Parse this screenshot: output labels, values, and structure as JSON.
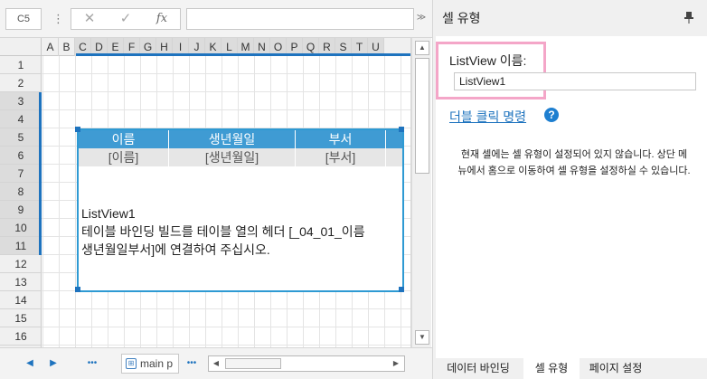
{
  "formula_bar": {
    "cell_ref": "C5",
    "more": "⋮",
    "cancel_glyph": "✕",
    "confirm_glyph": "✓",
    "function_label": "fx",
    "formula_value": "",
    "expand_glyph": "≫"
  },
  "grid": {
    "columns": [
      "A",
      "B",
      "C",
      "D",
      "E",
      "F",
      "G",
      "H",
      "I",
      "J",
      "K",
      "L",
      "M",
      "N",
      "O",
      "P",
      "Q",
      "R",
      "S",
      "T",
      "U"
    ],
    "rows": [
      "1",
      "2",
      "3",
      "4",
      "5",
      "6",
      "7",
      "8",
      "9",
      "10",
      "11",
      "12",
      "13",
      "14",
      "15",
      "16"
    ],
    "selected_columns": [
      "C",
      "D",
      "E",
      "F",
      "G",
      "H",
      "I",
      "J",
      "K",
      "L",
      "M",
      "N",
      "O",
      "P",
      "Q",
      "R",
      "S",
      "T",
      "U"
    ],
    "selected_rows": [
      "3",
      "4",
      "5",
      "6",
      "7",
      "8",
      "9",
      "10",
      "11"
    ]
  },
  "listview": {
    "headers": [
      "이름",
      "생년월일",
      "부서"
    ],
    "bindings": [
      "[이름]",
      "[생년월일]",
      "[부서]"
    ],
    "message_line1": "ListView1",
    "message_line2": "테이블 바인딩 빌드를 테이블 열의 헤더 [_04_01_이름",
    "message_line3": "생년월일부서]에 연결하여 주십시오."
  },
  "bottom_bar": {
    "prev_glyph": "◀",
    "next_glyph": "▶",
    "more_left": "•••",
    "sheet_tab_label": "main p",
    "more_right": "•••",
    "hscroll_left": "◀",
    "hscroll_right": "▶"
  },
  "vscroll": {
    "up": "▲",
    "down": "▼"
  },
  "panel": {
    "title": "셀 유형",
    "pin_glyph": "📌",
    "listview_name_label": "ListView 이름:",
    "listview_name_value": "ListView1",
    "double_click_link": "더블 클릭 명령",
    "help_glyph": "?",
    "info_text": "현재 셀에는 셀 유형이 설정되어 있지 않습니다. 상단 메뉴에서 홈으로 이동하여 셀 유형을 설정하실 수 있습니다.",
    "tabs": [
      "데이터 바인딩",
      "셀 유형",
      "페이지 설정"
    ],
    "active_tab": "셀 유형"
  },
  "colors": {
    "accent": "#1e73be",
    "listview_header": "#3f9bd3",
    "highlight": "#f4a6c8"
  }
}
